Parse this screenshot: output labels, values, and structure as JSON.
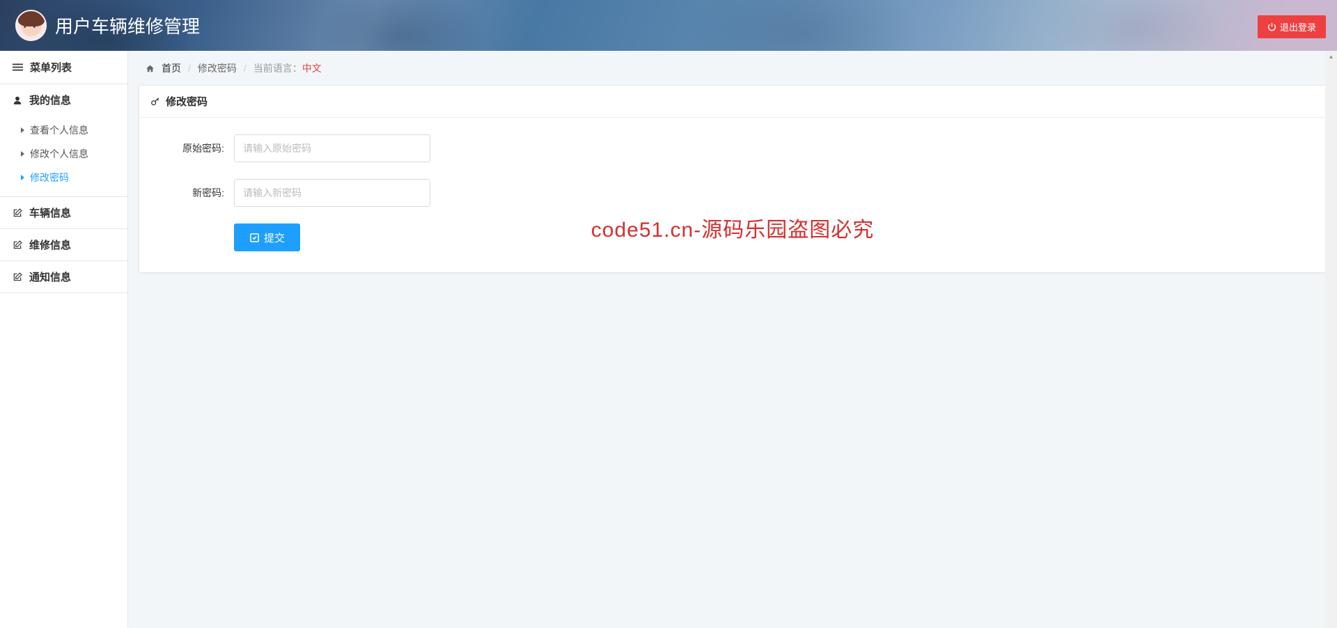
{
  "header": {
    "title": "用户车辆维修管理",
    "logout_label": "退出登录"
  },
  "sidebar": {
    "header": "菜单列表",
    "sections": [
      {
        "label": "我的信息",
        "icon": "user",
        "children": [
          {
            "label": "查看个人信息",
            "active": false
          },
          {
            "label": "修改个人信息",
            "active": false
          },
          {
            "label": "修改密码",
            "active": true
          }
        ]
      },
      {
        "label": "车辆信息",
        "icon": "edit",
        "children": []
      },
      {
        "label": "维修信息",
        "icon": "edit",
        "children": []
      },
      {
        "label": "通知信息",
        "icon": "edit",
        "children": []
      }
    ]
  },
  "breadcrumb": {
    "home": "首页",
    "current": "修改密码",
    "lang_prefix": "当前语言：",
    "lang_value": "中文"
  },
  "panel": {
    "title": "修改密码"
  },
  "form": {
    "old_password": {
      "label": "原始密码:",
      "placeholder": "请输入原始密码"
    },
    "new_password": {
      "label": "新密码:",
      "placeholder": "请输入新密码"
    },
    "submit_label": "提交"
  },
  "watermark": "code51.cn-源码乐园盗图必究"
}
